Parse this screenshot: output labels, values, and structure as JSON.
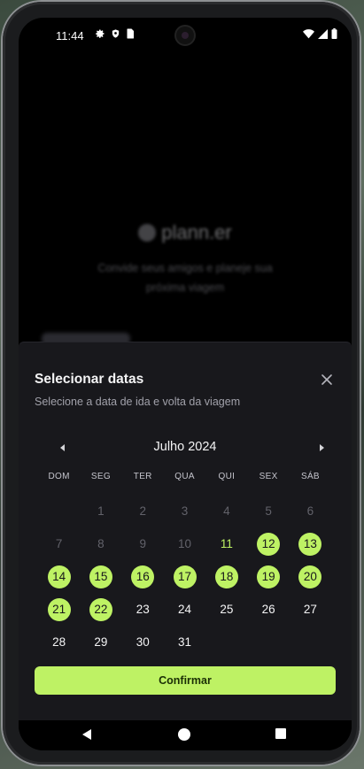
{
  "status_bar": {
    "time": "11:44",
    "left_icons": [
      "gear-icon",
      "shield-icon",
      "sim-card-icon"
    ],
    "right_icons": [
      "wifi-icon",
      "signal-icon",
      "battery-icon"
    ]
  },
  "background_app": {
    "logo_text": "plann.er",
    "tagline": "Convide seus amigos e planeje sua próxima viagem"
  },
  "date_sheet": {
    "title": "Selecionar datas",
    "subtitle": "Selecione a data de ida e volta da viagem",
    "close_icon": "close-icon",
    "month_label": "Julho 2024",
    "prev_icon": "chevron-left-icon",
    "next_icon": "chevron-right-icon",
    "weekdays": [
      "DOM",
      "SEG",
      "TER",
      "QUA",
      "QUI",
      "SEX",
      "SÁB"
    ],
    "days": [
      {
        "label": "",
        "state": "empty"
      },
      {
        "label": "1",
        "state": "disabled"
      },
      {
        "label": "2",
        "state": "disabled"
      },
      {
        "label": "3",
        "state": "disabled"
      },
      {
        "label": "4",
        "state": "disabled"
      },
      {
        "label": "5",
        "state": "disabled"
      },
      {
        "label": "6",
        "state": "disabled"
      },
      {
        "label": "7",
        "state": "disabled"
      },
      {
        "label": "8",
        "state": "disabled"
      },
      {
        "label": "9",
        "state": "disabled"
      },
      {
        "label": "10",
        "state": "disabled"
      },
      {
        "label": "11",
        "state": "today"
      },
      {
        "label": "12",
        "state": "selected"
      },
      {
        "label": "13",
        "state": "selected"
      },
      {
        "label": "14",
        "state": "selected"
      },
      {
        "label": "15",
        "state": "selected"
      },
      {
        "label": "16",
        "state": "selected"
      },
      {
        "label": "17",
        "state": "selected"
      },
      {
        "label": "18",
        "state": "selected"
      },
      {
        "label": "19",
        "state": "selected"
      },
      {
        "label": "20",
        "state": "selected"
      },
      {
        "label": "21",
        "state": "selected"
      },
      {
        "label": "22",
        "state": "selected"
      },
      {
        "label": "23",
        "state": "normal"
      },
      {
        "label": "24",
        "state": "normal"
      },
      {
        "label": "25",
        "state": "normal"
      },
      {
        "label": "26",
        "state": "normal"
      },
      {
        "label": "27",
        "state": "normal"
      },
      {
        "label": "28",
        "state": "normal"
      },
      {
        "label": "29",
        "state": "normal"
      },
      {
        "label": "30",
        "state": "normal"
      },
      {
        "label": "31",
        "state": "normal"
      }
    ],
    "confirm_label": "Confirmar"
  },
  "colors": {
    "accent": "#bef264",
    "sheet_bg": "#18181c",
    "disabled_text": "#62626a"
  },
  "nav_bar": {
    "icons": [
      "back-icon",
      "home-icon",
      "recents-icon"
    ]
  }
}
